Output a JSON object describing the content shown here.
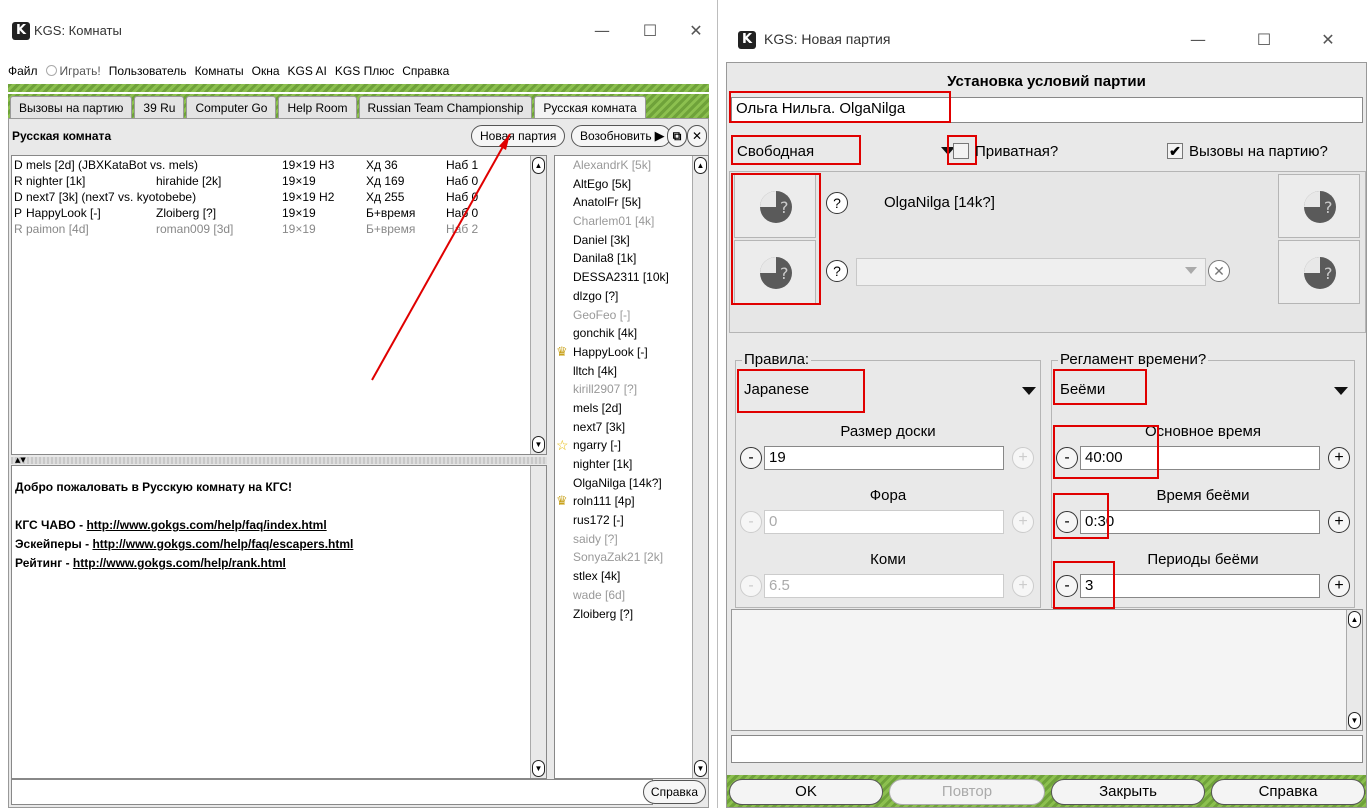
{
  "rooms_window": {
    "title": "KGS: Комнаты",
    "menu": [
      "Файл",
      "Играть!",
      "Пользователь",
      "Комнаты",
      "Окна",
      "KGS AI",
      "KGS Плюс",
      "Справка"
    ],
    "tabs": [
      "Вызовы на партию",
      "39 Ru",
      "Computer Go",
      "Help Room",
      "Russian Team Championship",
      "Русская комната"
    ],
    "room_title": "Русская комната",
    "new_game_button": "Новая партия",
    "resume_button": "Возобновить",
    "games": [
      {
        "type": "D",
        "player1": "mels [2d] (JBXKataBot vs. mels)",
        "player2": "",
        "board": "19×19 H3",
        "moves": "Хд 36",
        "observers": "Наб 1",
        "dim": false
      },
      {
        "type": "R",
        "player1": "nighter [1k]",
        "player2": "hirahide [2k]",
        "board": "19×19",
        "moves": "Хд 169",
        "observers": "Наб 0",
        "dim": false
      },
      {
        "type": "D",
        "player1": "next7 [3k] (next7 vs. kyotobebe)",
        "player2": "",
        "board": "19×19 H2",
        "moves": "Хд 255",
        "observers": "Наб 0",
        "dim": false
      },
      {
        "type": "P",
        "player1": "HappyLook [-]",
        "player2": "Zloiberg [?]",
        "board": "19×19",
        "moves": "Б+время",
        "observers": "Наб 0",
        "dim": false
      },
      {
        "type": "R",
        "player1": "paimon [4d]",
        "player2": "roman009 [3d]",
        "board": "19×19",
        "moves": "Б+время",
        "observers": "Наб 2",
        "dim": true
      }
    ],
    "welcome_text": "Добро пожаловать в Русскую комнату на КГС!",
    "links": [
      {
        "label": "КГС ЧАВО - ",
        "url": "http://www.gokgs.com/help/faq/index.html"
      },
      {
        "label": "Эскейперы - ",
        "url": "http://www.gokgs.com/help/faq/escapers.html"
      },
      {
        "label": "Рейтинг - ",
        "url": "http://www.gokgs.com/help/rank.html"
      }
    ],
    "users": [
      {
        "name": "AlexandrK [5k]",
        "dim": true,
        "mark": ""
      },
      {
        "name": "AltEgo [5k]",
        "dim": false,
        "mark": ""
      },
      {
        "name": "AnatolFr [5k]",
        "dim": false,
        "mark": ""
      },
      {
        "name": "Charlem01 [4k]",
        "dim": true,
        "mark": ""
      },
      {
        "name": "Daniel [3k]",
        "dim": false,
        "mark": ""
      },
      {
        "name": "Danila8 [1k]",
        "dim": false,
        "mark": ""
      },
      {
        "name": "DESSA2311 [10k]",
        "dim": false,
        "mark": ""
      },
      {
        "name": "dlzgo [?]",
        "dim": false,
        "mark": ""
      },
      {
        "name": "GeoFeo [-]",
        "dim": true,
        "mark": ""
      },
      {
        "name": "gonchik [4k]",
        "dim": false,
        "mark": ""
      },
      {
        "name": "HappyLook [-]",
        "dim": false,
        "mark": "crown"
      },
      {
        "name": "lltch [4k]",
        "dim": false,
        "mark": ""
      },
      {
        "name": "kirill2907 [?]",
        "dim": true,
        "mark": ""
      },
      {
        "name": "mels [2d]",
        "dim": false,
        "mark": ""
      },
      {
        "name": "next7 [3k]",
        "dim": false,
        "mark": ""
      },
      {
        "name": "ngarry [-]",
        "dim": false,
        "mark": "star"
      },
      {
        "name": "nighter [1k]",
        "dim": false,
        "mark": ""
      },
      {
        "name": "OlgaNilga [14k?]",
        "dim": false,
        "mark": ""
      },
      {
        "name": "roln111 [4p]",
        "dim": false,
        "mark": "crown"
      },
      {
        "name": "rus172 [-]",
        "dim": false,
        "mark": ""
      },
      {
        "name": "saidy [?]",
        "dim": true,
        "mark": ""
      },
      {
        "name": "SonyaZak21 [2k]",
        "dim": true,
        "mark": ""
      },
      {
        "name": "stlex [4k]",
        "dim": false,
        "mark": ""
      },
      {
        "name": "wade [6d]",
        "dim": true,
        "mark": ""
      },
      {
        "name": "Zloiberg [?]",
        "dim": false,
        "mark": ""
      }
    ],
    "help_button": "Справка"
  },
  "game_window": {
    "title": "KGS: Новая партия",
    "header": "Установка условий партии",
    "game_name": "Ольга Нильга. OlgaNilga",
    "game_type": "Свободная",
    "private_label": "Приватная?",
    "challenges_label": "Вызовы на партию?",
    "player_name": "OlgaNilga [14k?]",
    "rules_legend": "Правила:",
    "rules_value": "Japanese",
    "time_legend": "Регламент времени?",
    "time_value": "Беёми",
    "board_size_label": "Размер доски",
    "board_size_value": "19",
    "handicap_label": "Фора",
    "handicap_value": "0",
    "komi_label": "Коми",
    "komi_value": "6.5",
    "main_time_label": "Основное время",
    "main_time_value": "40:00",
    "byoyomi_time_label": "Время беёми",
    "byoyomi_time_value": "0:30",
    "byoyomi_periods_label": "Периоды беёми",
    "byoyomi_periods_value": "3",
    "buttons": {
      "ok": "OK",
      "repeat": "Повтор",
      "close": "Закрыть",
      "help": "Справка"
    }
  }
}
